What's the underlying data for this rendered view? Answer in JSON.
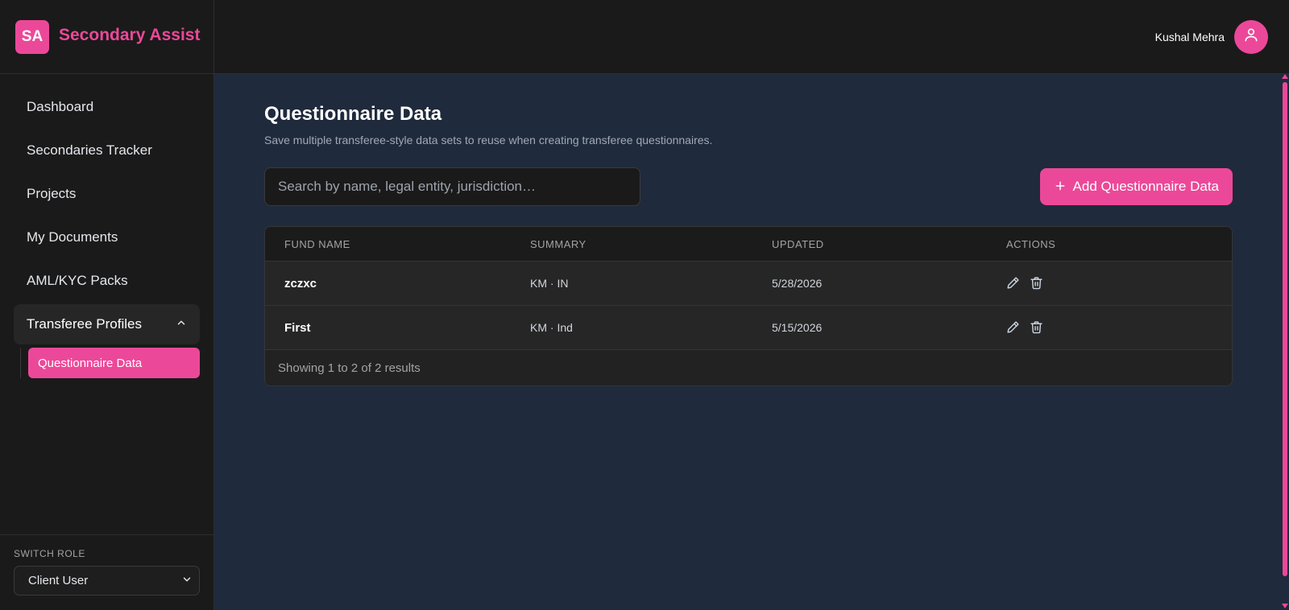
{
  "brand": {
    "logo_text": "SA",
    "name": "Secondary Assist"
  },
  "user": {
    "name": "Kushal Mehra"
  },
  "sidebar": {
    "items": [
      {
        "label": "Dashboard"
      },
      {
        "label": "Secondaries Tracker"
      },
      {
        "label": "Projects"
      },
      {
        "label": "My Documents"
      },
      {
        "label": "AML/KYC Packs"
      }
    ],
    "group": {
      "label": "Transferee Profiles",
      "expanded": true
    },
    "subitem": {
      "label": "Questionnaire Data",
      "active": true
    },
    "switch_role": {
      "label": "SWITCH ROLE",
      "value": "Client User"
    }
  },
  "main": {
    "title": "Questionnaire Data",
    "subtitle": "Save multiple transferee-style data sets to reuse when creating transferee questionnaires.",
    "search": {
      "placeholder": "Search by name, legal entity, jurisdiction…",
      "value": ""
    },
    "add_button": "Add Questionnaire Data",
    "table": {
      "headers": [
        "FUND NAME",
        "SUMMARY",
        "UPDATED",
        "ACTIONS"
      ],
      "rows": [
        {
          "fund_name": "zczxc",
          "summary": "KM · IN",
          "updated": "5/28/2026"
        },
        {
          "fund_name": "First",
          "summary": "KM · Ind",
          "updated": "5/15/2026"
        }
      ],
      "footer": "Showing 1 to 2 of 2 results"
    }
  },
  "colors": {
    "accent": "#ec4899",
    "sidebar_bg": "#1a1a1a",
    "main_bg": "#1f2a3c"
  },
  "icons": {
    "avatar": "user-icon",
    "group_toggle": "chevron-up-icon",
    "select": "chevron-down-icon",
    "edit": "pencil-icon",
    "delete": "trash-icon",
    "add": "plus-icon"
  }
}
